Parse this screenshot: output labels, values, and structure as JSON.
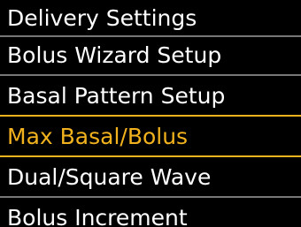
{
  "screen": {
    "title": "Delivery Settings",
    "accent_color": "#f2b21e",
    "items": [
      {
        "label": "Bolus Wizard Setup",
        "selected": false
      },
      {
        "label": "Basal Pattern Setup",
        "selected": false
      },
      {
        "label": "Max Basal/Bolus",
        "selected": true
      },
      {
        "label": "Dual/Square Wave",
        "selected": false
      },
      {
        "label": "Bolus Increment",
        "selected": false
      }
    ]
  }
}
